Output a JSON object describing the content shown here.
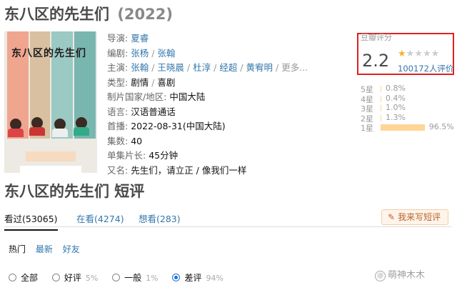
{
  "title": {
    "name": "东八区的先生们",
    "year": "(2022)"
  },
  "poster": {
    "title_text": "东八区的先生们"
  },
  "info": {
    "director_label": "导演:",
    "director": "夏睿",
    "writer_label": "编剧:",
    "writers": [
      "张杨",
      "张翰"
    ],
    "cast_label": "主演:",
    "cast": [
      "张翰",
      "王晓晨",
      "杜淳",
      "经超",
      "黄宥明"
    ],
    "cast_more": "更多...",
    "genre_label": "类型:",
    "genres": [
      "剧情",
      "喜剧"
    ],
    "country_label": "制片国家/地区:",
    "country": "中国大陆",
    "language_label": "语言:",
    "language": "汉语普通话",
    "air_label": "首播:",
    "air_date": "2022-08-31(中国大陆)",
    "episodes_label": "集数:",
    "episodes": "40",
    "runtime_label": "单集片长:",
    "runtime": "45分钟",
    "aka_label": "又名:",
    "aka": "先生们，请立正 / 像我们一样"
  },
  "rating": {
    "label": "豆瓣评分",
    "score": "2.2",
    "stars_filled": 1,
    "stars_total": 5,
    "count_text": "100172人评价",
    "distribution": [
      {
        "label": "5星",
        "percent": 0.8,
        "text": "0.8%"
      },
      {
        "label": "4星",
        "percent": 0.4,
        "text": "0.4%"
      },
      {
        "label": "3星",
        "percent": 1.0,
        "text": "1.0%"
      },
      {
        "label": "2星",
        "percent": 1.3,
        "text": "1.3%"
      },
      {
        "label": "1星",
        "percent": 96.5,
        "text": "96.5%"
      }
    ]
  },
  "section_title": "东八区的先生们 短评",
  "tabs": [
    {
      "label": "看过(53065)",
      "active": true
    },
    {
      "label": "在看(4274)",
      "active": false
    },
    {
      "label": "想看(283)",
      "active": false
    }
  ],
  "write_button": "我来写短评",
  "sorts": [
    "热门",
    "最新",
    "好友"
  ],
  "filters": [
    {
      "label": "全部",
      "pct": ""
    },
    {
      "label": "好评",
      "pct": "5%"
    },
    {
      "label": "一般",
      "pct": "1%"
    },
    {
      "label": "差评",
      "pct": "94%"
    }
  ],
  "watermark": "萌神木木",
  "colors": {
    "link": "#3377aa",
    "star": "#ffac2d",
    "highlight_box": "#e02020",
    "bar": "#ffd596"
  }
}
